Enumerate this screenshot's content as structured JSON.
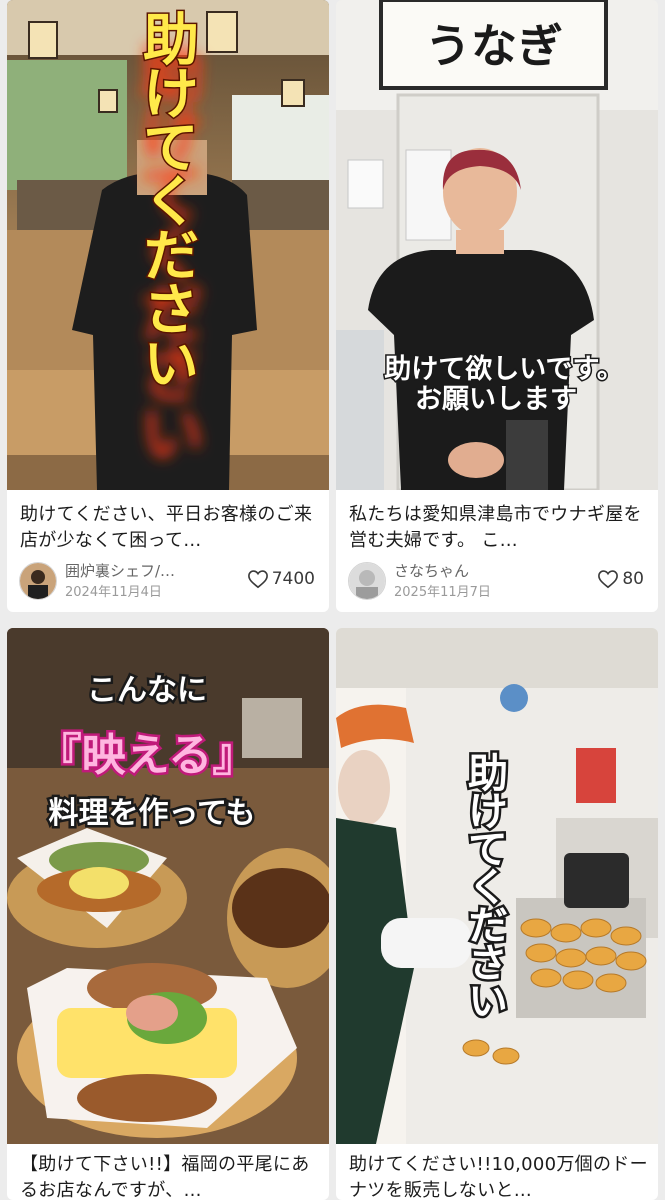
{
  "cards": [
    {
      "overlay_text": "助けてください",
      "title": "助けてください、平日お客様のご来店が少なくて困って…",
      "author": "囲炉裏シェフ/…",
      "date": "2024年11月4日",
      "likes": "7400"
    },
    {
      "overlay_line1": "助けて欲しいです。",
      "overlay_line2": "お願いします",
      "sign_text": "うなぎ",
      "title": "私たちは愛知県津島市でウナギ屋を営む夫婦です。 こ…",
      "author": "さなちゃん",
      "date": "2025年11月7日",
      "likes": "80"
    },
    {
      "overlay_line1": "こんなに",
      "overlay_line2": "『映える』",
      "overlay_line3": "料理を作っても",
      "title": "【助けて下さい!!】福岡の平尾にあるお店なんですが、…"
    },
    {
      "overlay_text": "助けてください",
      "title": "助けてください!!10,000万個のドーナツを販売しないと…"
    }
  ],
  "colors": {
    "background": "#ececec",
    "card": "#ffffff",
    "title_text": "#1c1c1c",
    "meta_text": "#666666",
    "date_text": "#9a9a9a",
    "overlay_yellow": "#ffe94a",
    "overlay_red_glow": "#e0260f"
  },
  "icons": {
    "likes": "heart-outline-icon",
    "author": "avatar"
  }
}
